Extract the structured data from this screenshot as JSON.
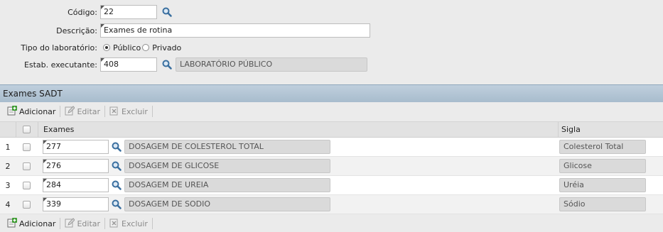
{
  "form": {
    "codigo": {
      "label": "Código:",
      "value": "22"
    },
    "descricao": {
      "label": "Descrição:",
      "value": "Exames de rotina"
    },
    "tipo": {
      "label": "Tipo do laboratório:",
      "option_publico": "Público",
      "option_privado": "Privado",
      "selected": "Público"
    },
    "estab": {
      "label": "Estab. executante:",
      "value": "408",
      "name": "LABORATÓRIO PÚBLICO"
    }
  },
  "section": {
    "title": "Exames SADT"
  },
  "toolbar": {
    "add": "Adicionar",
    "edit": "Editar",
    "delete": "Excluir"
  },
  "grid": {
    "col_exames": "Exames",
    "col_sigla": "Sigla",
    "rows": [
      {
        "num": "1",
        "code": "277",
        "name": "DOSAGEM DE COLESTEROL TOTAL",
        "sigla": "Colesterol Total"
      },
      {
        "num": "2",
        "code": "276",
        "name": "DOSAGEM DE GLICOSE",
        "sigla": "Glicose"
      },
      {
        "num": "3",
        "code": "284",
        "name": "DOSAGEM DE UREIA",
        "sigla": "Uréia"
      },
      {
        "num": "4",
        "code": "339",
        "name": "DOSAGEM DE SODIO",
        "sigla": "Sódio"
      }
    ]
  },
  "colors": {
    "header_blue": "#a8bccd",
    "accent": "#4a7fb5",
    "add_green": "#3a9a2e"
  },
  "icons": [
    "search-icon",
    "add-icon",
    "edit-icon",
    "delete-icon"
  ]
}
